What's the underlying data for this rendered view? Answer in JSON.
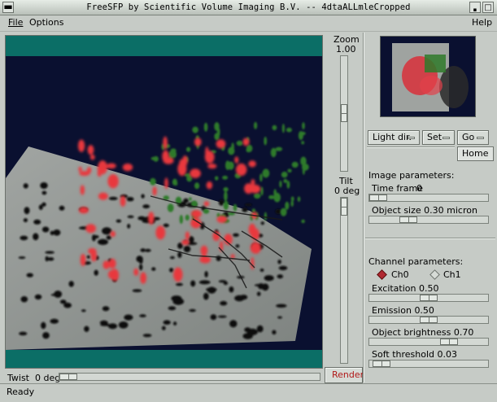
{
  "window": {
    "title": "FreeSFP by Scientific Volume Imaging B.V. -- 4dtaALLmleCropped"
  },
  "menubar": {
    "file": "File",
    "options": "Options",
    "help": "Help"
  },
  "zoom": {
    "label": "Zoom",
    "value": "1.00",
    "level": 0.5
  },
  "tilt": {
    "label": "Tilt",
    "value": "0 deg",
    "level": 0.0
  },
  "twist": {
    "label": "Twist",
    "value": "0 deg",
    "level": 0.0
  },
  "render_button": "Render",
  "controls": {
    "light_dir": "Light dir.",
    "set": "Set",
    "go": "Go",
    "home": "Home"
  },
  "image_parameters": {
    "heading": "Image parameters:",
    "time_frame_label": "Time frame",
    "time_frame_value": "0",
    "time_frame_level": 0.0,
    "object_size_label": "Object size 0.30 micron",
    "object_size_level": 0.3
  },
  "channel_parameters": {
    "heading": "Channel parameters:",
    "channels": [
      "Ch0",
      "Ch1"
    ],
    "selected_channel": "Ch0",
    "excitation_label": "Excitation 0.50",
    "excitation_level": 0.5,
    "emission_label": "Emission 0.50",
    "emission_level": 0.5,
    "brightness_label": "Object brightness 0.70",
    "brightness_level": 0.7,
    "soft_threshold_label": "Soft threshold 0.03",
    "soft_threshold_level": 0.03
  },
  "status": "Ready",
  "colors": {
    "viewport_bg": "#0a1030",
    "teal_band": "#0b6e66",
    "plane": "#8d918e",
    "red_object": "#e8383e",
    "green_object": "#2f7a2a",
    "render_text": "#b01818"
  }
}
